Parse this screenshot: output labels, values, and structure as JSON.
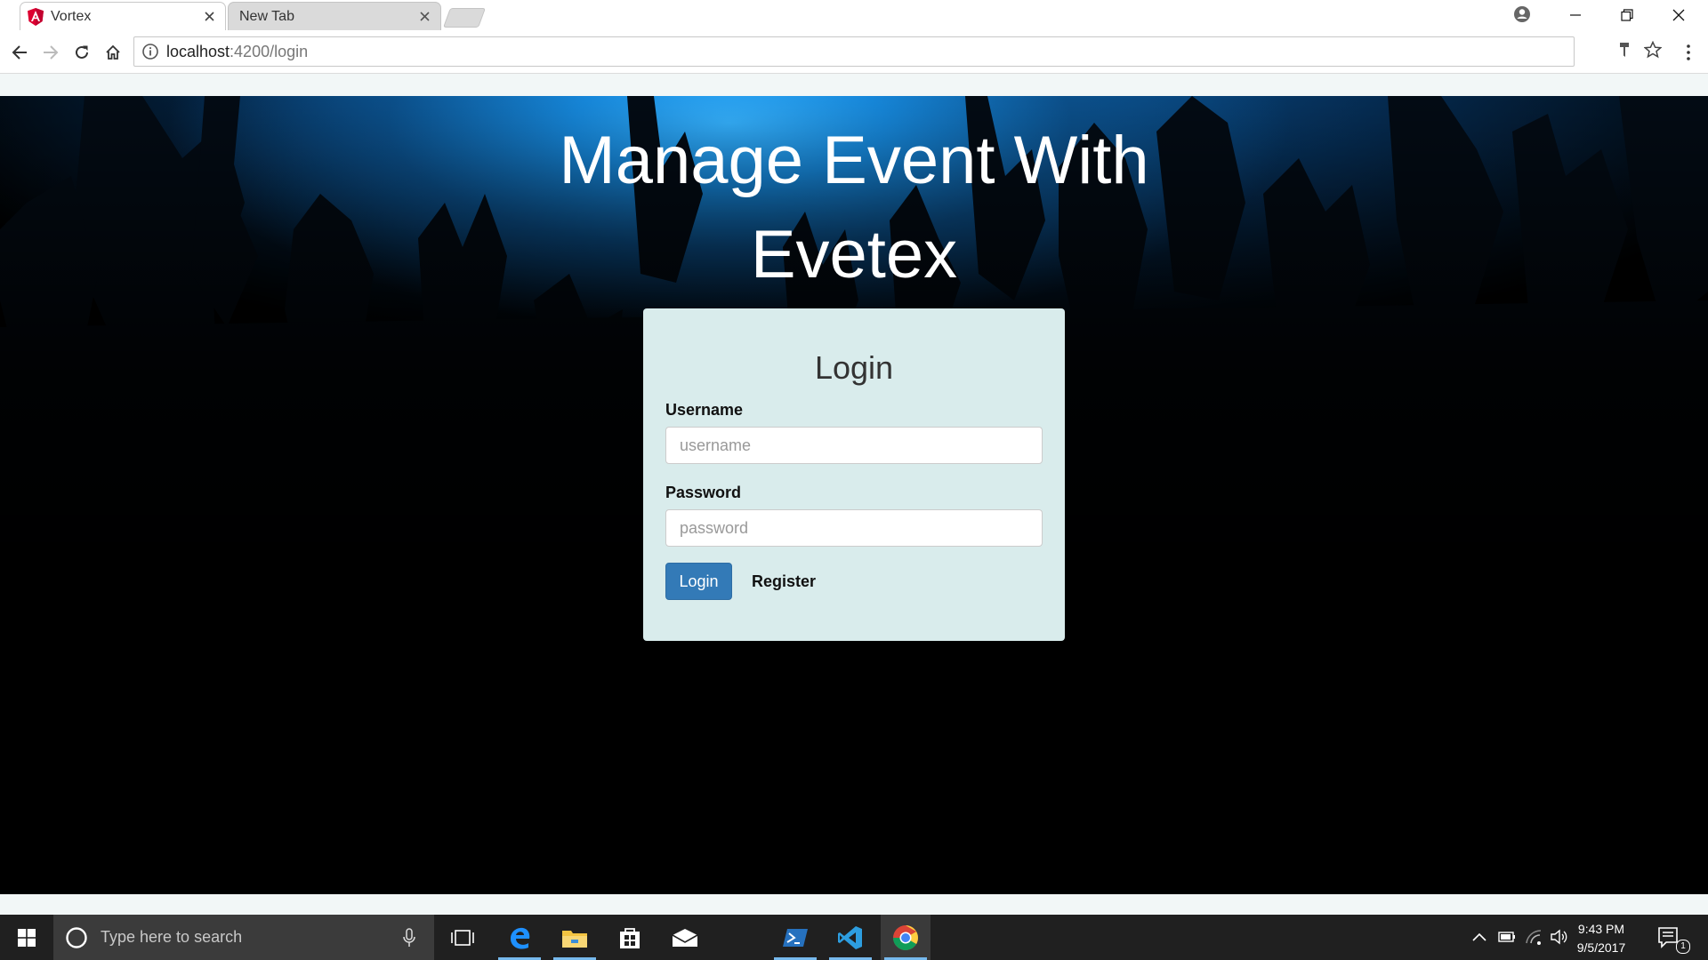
{
  "browser": {
    "tabs": [
      {
        "title": "Vortex",
        "active": true
      },
      {
        "title": "New Tab",
        "active": false
      }
    ],
    "address": {
      "host": "localhost",
      "path": ":4200/login"
    }
  },
  "page": {
    "hero_title": "Manage Event With Evetex",
    "login": {
      "title": "Login",
      "username_label": "Username",
      "username_placeholder": "username",
      "username_value": "",
      "password_label": "Password",
      "password_placeholder": "password",
      "password_value": "",
      "login_button": "Login",
      "register_link": "Register"
    },
    "colors": {
      "card_background": "#d9ecec",
      "primary_button": "#337ab7",
      "hero_accent": "#1687da"
    }
  },
  "taskbar": {
    "search_placeholder": "Type here to search",
    "time": "9:43 PM",
    "date": "9/5/2017",
    "notification_count": "1",
    "pinned_icons": [
      "task-view-icon",
      "edge-icon",
      "file-explorer-icon",
      "store-icon",
      "mail-icon",
      "powershell-icon",
      "visual-studio-code-icon",
      "chrome-icon"
    ],
    "tray_icons": [
      "chevron-up-icon",
      "battery-icon",
      "wifi-icon",
      "volume-icon",
      "action-center-icon"
    ]
  }
}
